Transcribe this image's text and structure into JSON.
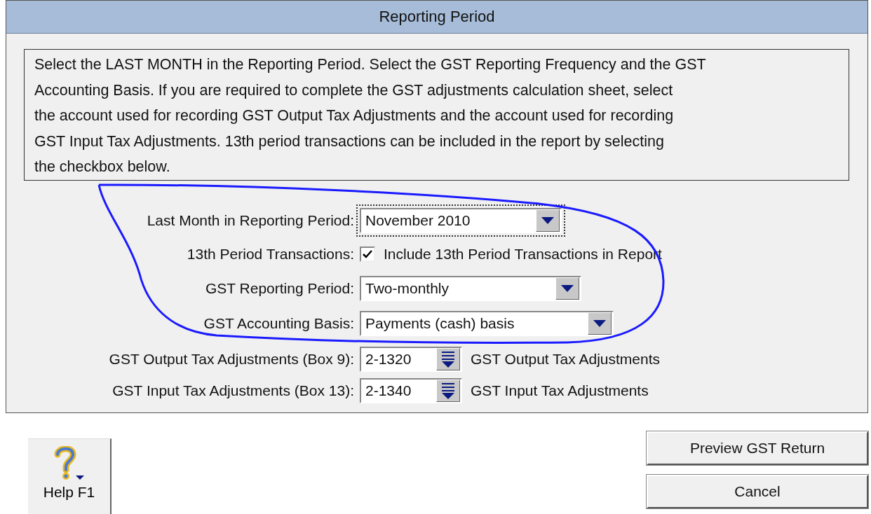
{
  "window": {
    "title": "Reporting Period"
  },
  "instructions": "Select the LAST MONTH in the Reporting Period. Select the GST Reporting Frequency and the GST\nAccounting Basis. If you are required to complete the GST adjustments calculation sheet, select\nthe account used for recording GST Output Tax Adjustments and the account used for recording\nGST Input Tax Adjustments. 13th period transactions can be included in the report by selecting\nthe checkbox below.",
  "fields": [
    {
      "kind": "dropdown",
      "label": "Last Month in Reporting Period:",
      "value": "November 2010",
      "focused": true
    },
    {
      "kind": "checkbox",
      "label": "13th Period Transactions:",
      "text": "Include 13th Period Transactions in Report",
      "checked": true
    },
    {
      "kind": "dropdown",
      "label": "GST Reporting Period:",
      "value": "Two-monthly"
    },
    {
      "kind": "dropdown",
      "label": "GST Accounting Basis:",
      "value": "Payments (cash) basis"
    },
    {
      "kind": "lookup",
      "label": "GST Output Tax Adjustments (Box 9):",
      "value": "2-1320",
      "account": "GST Output Tax Adjustments"
    },
    {
      "kind": "lookup",
      "label": "GST Input Tax Adjustments (Box 13):",
      "value": "2-1340",
      "account": "GST Input Tax Adjustments"
    }
  ],
  "help_button": {
    "label": "Help F1"
  },
  "buttons": [
    {
      "label": "Preview GST Return"
    },
    {
      "label": "Cancel"
    }
  ]
}
